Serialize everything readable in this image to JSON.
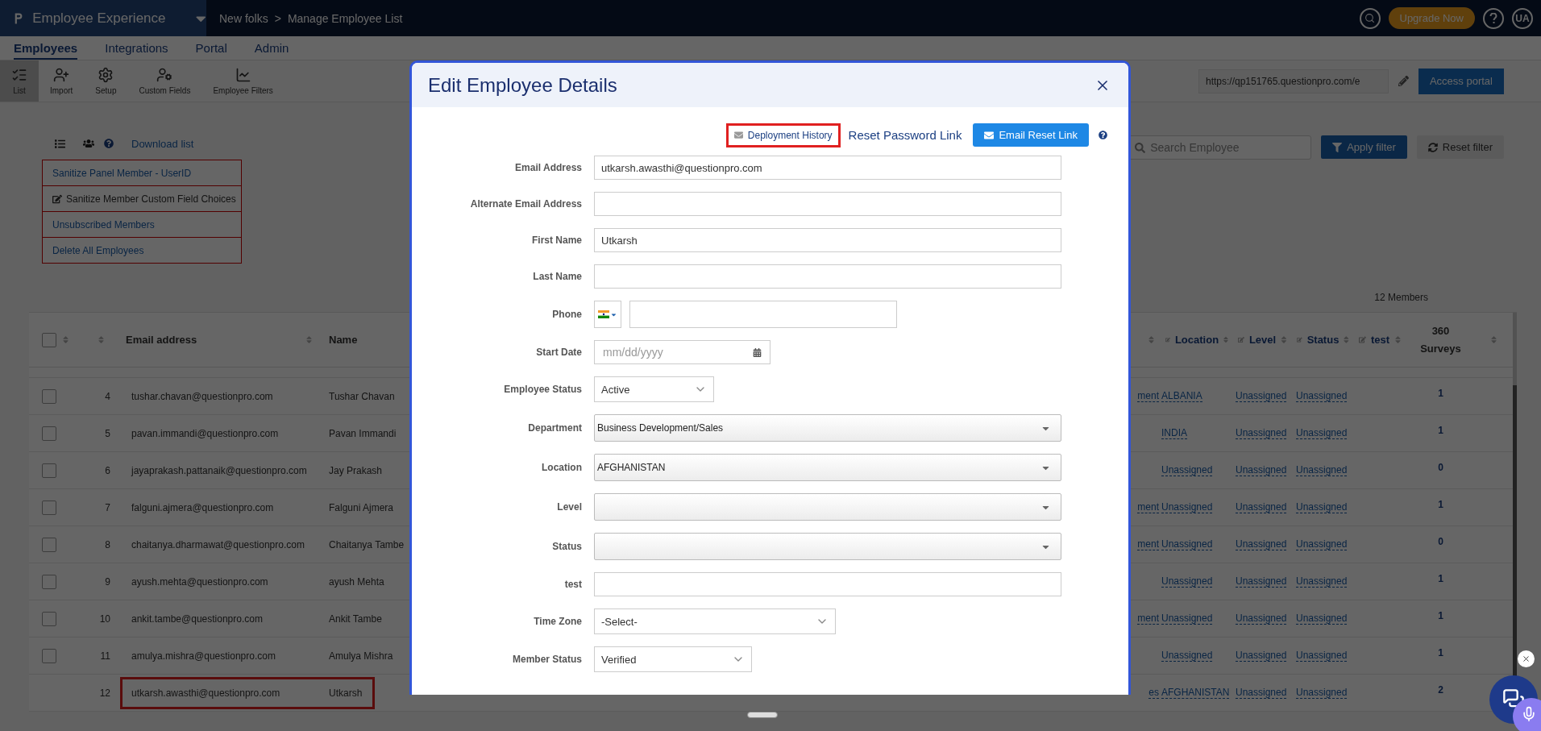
{
  "app_bar": {
    "brand": "Employee Experience",
    "breadcrumb": [
      "New folks",
      "Manage Employee List"
    ],
    "breadcrumb_separator": ">",
    "upgrade_button": "Upgrade Now",
    "avatar": "UA"
  },
  "nav_tabs": [
    {
      "label": "Employees",
      "selected": true
    },
    {
      "label": "Integrations",
      "selected": false
    },
    {
      "label": "Portal",
      "selected": false
    },
    {
      "label": "Admin",
      "selected": false
    }
  ],
  "toolbar": [
    {
      "label": "List",
      "kind": "list",
      "selected": true
    },
    {
      "label": "Import",
      "kind": "import",
      "selected": false
    },
    {
      "label": "Setup",
      "kind": "setup",
      "selected": false
    },
    {
      "label": "Custom Fields",
      "kind": "fields",
      "selected": false
    },
    {
      "label": "Employee Filters",
      "kind": "filters",
      "selected": false
    }
  ],
  "portal": {
    "url": "https://qp151765.questionpro.com/e",
    "button": "Access portal"
  },
  "list_actions": {
    "download": "Download list",
    "menu": [
      {
        "label": "Sanitize Panel Member - UserID",
        "kind": "link"
      },
      {
        "label": "Sanitize Member Custom Field Choices",
        "kind": "edit"
      },
      {
        "label": "Unsubscribed Members",
        "kind": "link"
      },
      {
        "label": "Delete All Employees",
        "kind": "link"
      }
    ]
  },
  "search": {
    "placeholder": "Search Employee"
  },
  "filter_buttons": [
    {
      "label": "Apply filter",
      "kind": "primary"
    },
    {
      "label": "Reset filter",
      "kind": "secondary"
    }
  ],
  "member_count": "12 Members",
  "table": {
    "select_all": {
      "checked": false
    },
    "columns": [
      {
        "label": "Email address"
      },
      {
        "label": "Name"
      },
      {
        "label": "Location"
      },
      {
        "label": "Level"
      },
      {
        "label": "Status"
      },
      {
        "label": "test"
      },
      {
        "label": "360 Surveys"
      }
    ],
    "rows": [
      {
        "checked": false,
        "number": "4",
        "email": "tushar.chavan@questionpro.com",
        "name": "Tushar Chavan",
        "column_5": "ment",
        "location": "ALBANIA",
        "level": "Unassigned",
        "status": "Unassigned",
        "surveys": "1",
        "highlighted": false
      },
      {
        "checked": false,
        "number": "5",
        "email": "pavan.immandi@questionpro.com",
        "name": "Pavan Immandi",
        "location": "INDIA",
        "level": "Unassigned",
        "status": "Unassigned",
        "surveys": "1",
        "highlighted": false
      },
      {
        "checked": false,
        "number": "6",
        "email": "jayaprakash.pattanaik@questionpro.com",
        "name": "Jay Prakash",
        "location": "Unassigned",
        "level": "Unassigned",
        "status": "Unassigned",
        "surveys": "0",
        "highlighted": false
      },
      {
        "checked": false,
        "number": "7",
        "email": "falguni.ajmera@questionpro.com",
        "name": "Falguni Ajmera",
        "column_5": "ment",
        "location": "Unassigned",
        "level": "Unassigned",
        "status": "Unassigned",
        "surveys": "1",
        "highlighted": false
      },
      {
        "checked": false,
        "number": "8",
        "email": "chaitanya.dharmawat@questionpro.com",
        "name": "Chaitanya Tambe",
        "column_5": "ment",
        "location": "Unassigned",
        "level": "Unassigned",
        "status": "Unassigned",
        "surveys": "0",
        "highlighted": false
      },
      {
        "checked": false,
        "number": "9",
        "email": "ayush.mehta@questionpro.com",
        "name": "ayush Mehta",
        "location": "Unassigned",
        "level": "Unassigned",
        "status": "Unassigned",
        "surveys": "1",
        "highlighted": false
      },
      {
        "checked": false,
        "number": "10",
        "email": "ankit.tambe@questionpro.com",
        "name": "Ankit Tambe",
        "column_5": "ment",
        "location": "Unassigned",
        "level": "Unassigned",
        "status": "Unassigned",
        "surveys": "1",
        "highlighted": false
      },
      {
        "checked": false,
        "number": "11",
        "email": "amulya.mishra@questionpro.com",
        "name": "Amulya Mishra",
        "location": "Unassigned",
        "level": "Unassigned",
        "status": "Unassigned",
        "surveys": "1",
        "highlighted": false
      },
      {
        "number": "12",
        "email": "utkarsh.awasthi@questionpro.com",
        "name": "Utkarsh",
        "column_5": "es",
        "location": "AFGHANISTAN",
        "level": "Unassigned",
        "status": "Unassigned",
        "surveys": "2",
        "highlighted": true
      }
    ]
  },
  "modal": {
    "title": "Edit Employee Details",
    "actions": {
      "deployment_history": "Deployment History",
      "reset_password": "Reset Password Link",
      "email_reset": "Email Reset Link"
    },
    "fields": [
      {
        "label": "Email Address",
        "kind": "text",
        "value": "utkarsh.awasthi@questionpro.com"
      },
      {
        "label": "Alternate Email Address",
        "kind": "text"
      },
      {
        "label": "First Name",
        "kind": "text",
        "value": "Utkarsh"
      },
      {
        "label": "Last Name",
        "kind": "text"
      },
      {
        "label": "Phone",
        "kind": "phone"
      },
      {
        "label": "Start Date",
        "kind": "date",
        "placeholder": "mm/dd/yyyy"
      },
      {
        "label": "Employee Status",
        "kind": "select",
        "value": "Active"
      },
      {
        "label": "Department",
        "kind": "dropdown",
        "value": "Business Development/Sales"
      },
      {
        "label": "Location",
        "kind": "dropdown",
        "value": "AFGHANISTAN"
      },
      {
        "label": "Level",
        "kind": "dropdown"
      },
      {
        "label": "Status",
        "kind": "dropdown"
      },
      {
        "label": "test",
        "kind": "text"
      },
      {
        "label": "Time Zone",
        "kind": "select",
        "value": "-Select-"
      },
      {
        "label": "Member Status",
        "kind": "select",
        "value": "Verified"
      }
    ]
  }
}
